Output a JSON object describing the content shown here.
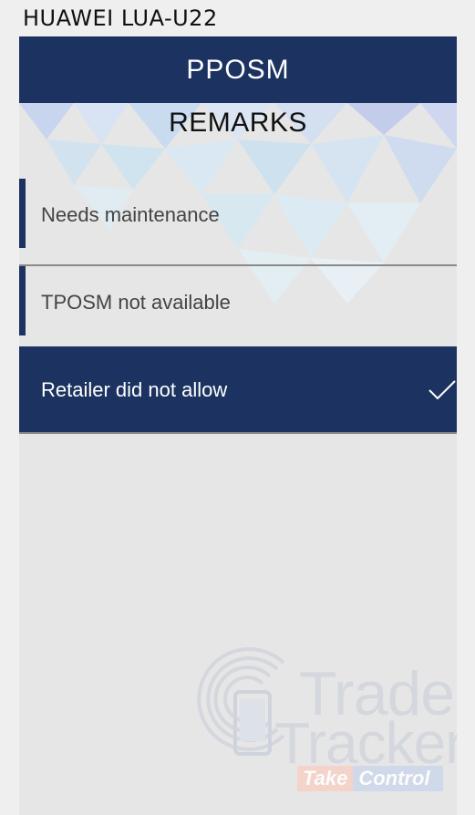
{
  "device": {
    "name": "HUAWEI LUA-U22"
  },
  "header": {
    "title": "PPOSM"
  },
  "section": {
    "title": "REMARKS"
  },
  "remarks": {
    "options": [
      {
        "label": "Needs maintenance",
        "selected": false
      },
      {
        "label": "TPOSM not available",
        "selected": false
      },
      {
        "label": "Retailer did not allow",
        "selected": true
      }
    ]
  },
  "watermark": {
    "line1": "Trade",
    "line2": "Tracker",
    "tag1": "Take",
    "tag2": "Control"
  },
  "colors": {
    "brand": "#1c3361",
    "background": "#e6e6e6",
    "divider": "#8a8a8a"
  }
}
